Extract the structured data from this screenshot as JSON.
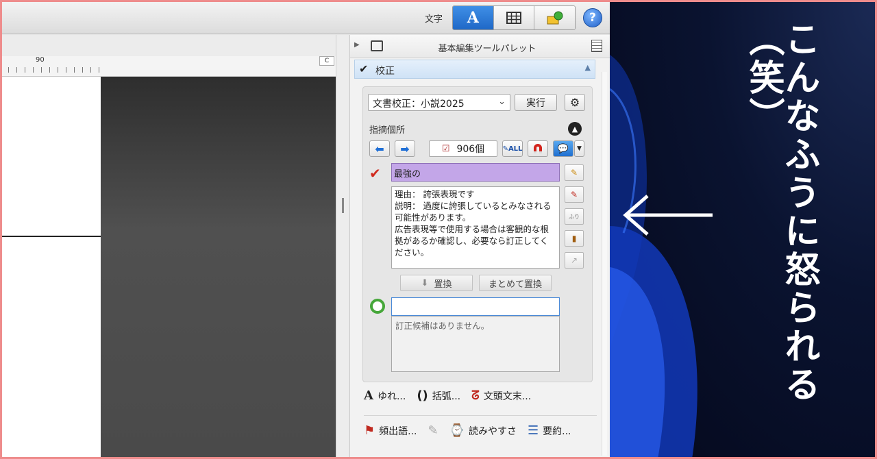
{
  "toolbar": {
    "moji_label": "文字",
    "seg_text_glyph": "A",
    "help_glyph": "?"
  },
  "ruler": {
    "number": "90",
    "corner": "C"
  },
  "panel": {
    "palette_title": "基本編集ツールパレット",
    "section_label": "校正",
    "profile_select": "文書校正：小説2025",
    "run_button": "実行",
    "findings_heading": "指摘個所",
    "count": "906個",
    "hit_text": "最強の",
    "reason_lines": "理由： 誇張表現です\n説明： 過度に誇張しているとみなされる可能性があります。\n広告表現等で使用する場合は客観的な根拠があるか確認し、必要なら訂正してください。",
    "replace_button": "置換",
    "replace_all_button": "まとめて置換",
    "answer_value": "",
    "no_candidates": "訂正候補はありません。",
    "tools_row1": [
      "ゆれ...",
      "括弧...",
      "文頭文末..."
    ],
    "tools_row2": [
      "頻出語...",
      "読みやすさ",
      "要約..."
    ]
  },
  "overlay": {
    "caption": "こんなふうに怒られる（笑）",
    "arrow": "←"
  },
  "colors": {
    "accent_blue": "#1f68c7",
    "hit_purple": "#c3a6e8",
    "ok_green": "#46a73a",
    "frame_pink": "#ee8c8c"
  }
}
